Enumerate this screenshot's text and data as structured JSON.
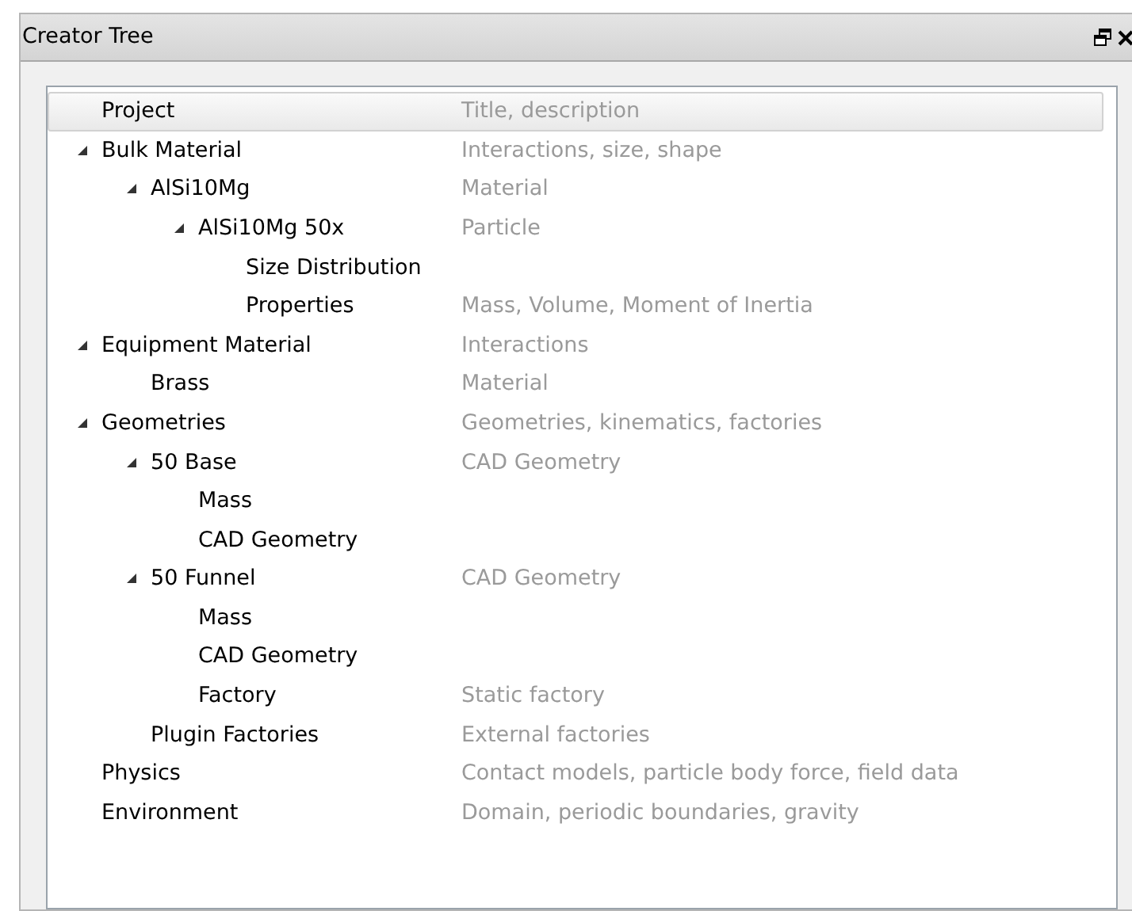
{
  "panel": {
    "title": "Creator Tree"
  },
  "tree": {
    "items": [
      {
        "name": "Project",
        "description": "Title, description",
        "selected": true
      },
      {
        "name": "Bulk Material",
        "description": "Interactions, size, shape",
        "selected": false,
        "expanded": true,
        "children": [
          {
            "name": "AlSi10Mg",
            "description": "Material",
            "selected": false,
            "expanded": true,
            "children": [
              {
                "name": "AlSi10Mg 50x",
                "description": "Particle",
                "selected": false,
                "expanded": true,
                "children": [
                  {
                    "name": "Size Distribution",
                    "selected": false
                  },
                  {
                    "name": "Properties",
                    "description": "Mass, Volume, Moment of Inertia",
                    "selected": false
                  }
                ]
              }
            ]
          }
        ]
      },
      {
        "name": "Equipment Material",
        "description": "Interactions",
        "selected": false,
        "expanded": true,
        "children": [
          {
            "name": "Brass",
            "description": "Material",
            "selected": false
          }
        ]
      },
      {
        "name": "Geometries",
        "description": "Geometries, kinematics, factories",
        "selected": false,
        "expanded": true,
        "children": [
          {
            "name": "50 Base",
            "description": "CAD Geometry",
            "selected": false,
            "expanded": true,
            "children": [
              {
                "name": "Mass",
                "selected": false
              },
              {
                "name": "CAD Geometry",
                "selected": false
              }
            ]
          },
          {
            "name": "50 Funnel",
            "description": "CAD Geometry",
            "selected": false,
            "expanded": true,
            "children": [
              {
                "name": "Mass",
                "selected": false
              },
              {
                "name": "CAD Geometry",
                "selected": false
              },
              {
                "name": "Factory",
                "description": "Static factory",
                "selected": false
              }
            ]
          },
          {
            "name": "Plugin Factories",
            "description": "External factories",
            "selected": false
          }
        ]
      },
      {
        "name": "Physics",
        "description": "Contact models, particle body force, field data",
        "selected": false
      },
      {
        "name": "Environment",
        "description": "Domain, periodic boundaries, gravity",
        "selected": false
      }
    ]
  }
}
